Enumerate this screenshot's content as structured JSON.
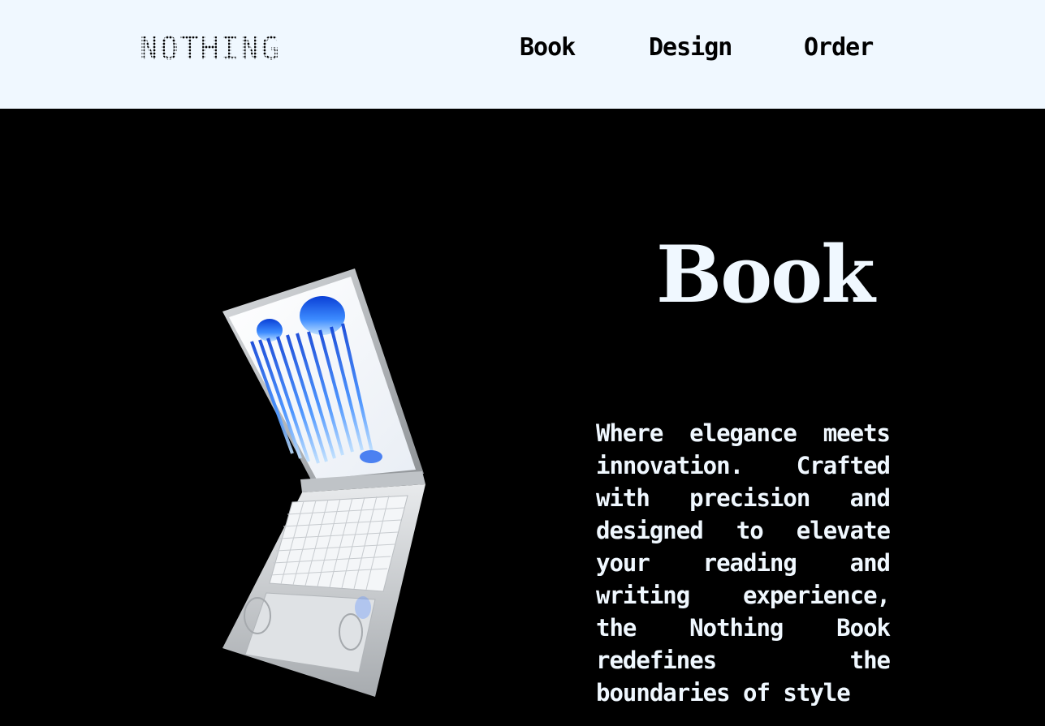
{
  "nav": {
    "logo": "NOTHING",
    "links": [
      "Book",
      "Design",
      "Order"
    ]
  },
  "hero": {
    "title": "Book",
    "description": "Where elegance meets innovation. Crafted with precision and designed to elevate your reading and writing experience, the Nothing Book redefines the boundaries of style"
  },
  "colors": {
    "nav_background": "#F0F8FF",
    "hero_background": "#000000",
    "hero_text": "#F0F8FF",
    "accent_blue": "#1E6FE8"
  },
  "icons": {
    "hero_image": "laptop-image"
  }
}
